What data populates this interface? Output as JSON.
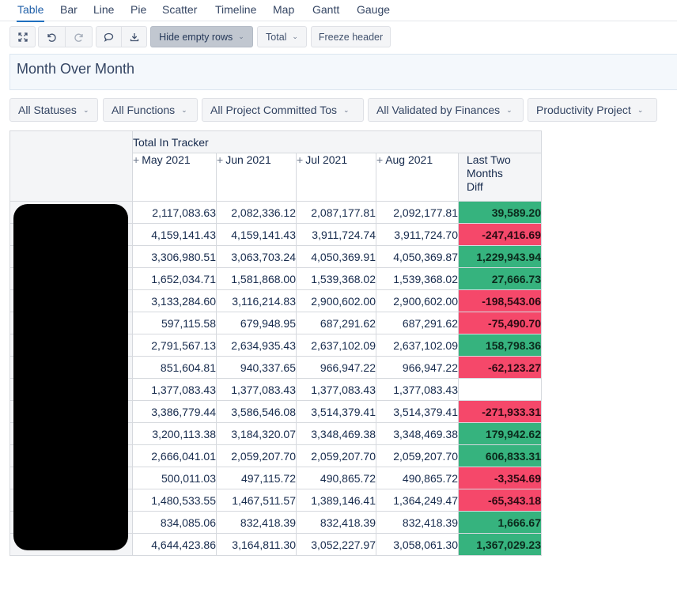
{
  "tabs": [
    "Table",
    "Bar",
    "Line",
    "Pie",
    "Scatter",
    "Timeline",
    "Map",
    "Gantt",
    "Gauge"
  ],
  "active_tab": "Table",
  "toolbar": {
    "hide_empty_rows": "Hide empty rows",
    "total": "Total",
    "freeze_header": "Freeze header",
    "chevron": "⌄"
  },
  "report": {
    "title": "Month Over Month"
  },
  "filters": [
    "All Statuses",
    "All Functions",
    "All Project Committed Tos",
    "All Validated by Finances",
    "Productivity Project"
  ],
  "table": {
    "group_header": "Total In Tracker",
    "columns": [
      {
        "label": "May 2021",
        "expand": "+"
      },
      {
        "label": "Jun 2021",
        "expand": "+"
      },
      {
        "label": "Jul 2021",
        "expand": "+"
      },
      {
        "label": "Aug 2021",
        "expand": "+"
      }
    ],
    "diff_header": [
      "Last Two",
      "Months",
      "Diff"
    ],
    "rows": [
      {
        "values": [
          "2,117,083.63",
          "2,082,336.12",
          "2,087,177.81",
          "2,092,177.81"
        ],
        "diff": "39,589.20",
        "sign": "pos"
      },
      {
        "values": [
          "4,159,141.43",
          "4,159,141.43",
          "3,911,724.74",
          "3,911,724.70"
        ],
        "diff": "-247,416.69",
        "sign": "neg"
      },
      {
        "values": [
          "3,306,980.51",
          "3,063,703.24",
          "4,050,369.91",
          "4,050,369.87"
        ],
        "diff": "1,229,943.94",
        "sign": "pos"
      },
      {
        "values": [
          "1,652,034.71",
          "1,581,868.00",
          "1,539,368.02",
          "1,539,368.02"
        ],
        "diff": "27,666.73",
        "sign": "pos"
      },
      {
        "values": [
          "3,133,284.60",
          "3,116,214.83",
          "2,900,602.00",
          "2,900,602.00"
        ],
        "diff": "-198,543.06",
        "sign": "neg"
      },
      {
        "values": [
          "597,115.58",
          "679,948.95",
          "687,291.62",
          "687,291.62"
        ],
        "diff": "-75,490.70",
        "sign": "neg"
      },
      {
        "values": [
          "2,791,567.13",
          "2,634,935.43",
          "2,637,102.09",
          "2,637,102.09"
        ],
        "diff": "158,798.36",
        "sign": "pos"
      },
      {
        "values": [
          "851,604.81",
          "940,337.65",
          "966,947.22",
          "966,947.22"
        ],
        "diff": "-62,123.27",
        "sign": "neg"
      },
      {
        "values": [
          "1,377,083.43",
          "1,377,083.43",
          "1,377,083.43",
          "1,377,083.43"
        ],
        "diff": "",
        "sign": "none"
      },
      {
        "values": [
          "3,386,779.44",
          "3,586,546.08",
          "3,514,379.41",
          "3,514,379.41"
        ],
        "diff": "-271,933.31",
        "sign": "neg"
      },
      {
        "values": [
          "3,200,113.38",
          "3,184,320.07",
          "3,348,469.38",
          "3,348,469.38"
        ],
        "diff": "179,942.62",
        "sign": "pos"
      },
      {
        "values": [
          "2,666,041.01",
          "2,059,207.70",
          "2,059,207.70",
          "2,059,207.70"
        ],
        "diff": "606,833.31",
        "sign": "pos"
      },
      {
        "values": [
          "500,011.03",
          "497,115.72",
          "490,865.72",
          "490,865.72"
        ],
        "diff": "-3,354.69",
        "sign": "neg"
      },
      {
        "values": [
          "1,480,533.55",
          "1,467,511.57",
          "1,389,146.41",
          "1,364,249.47"
        ],
        "diff": "-65,343.18",
        "sign": "neg"
      },
      {
        "values": [
          "834,085.06",
          "832,418.39",
          "832,418.39",
          "832,418.39"
        ],
        "diff": "1,666.67",
        "sign": "pos"
      },
      {
        "values": [
          "4,644,423.86",
          "3,164,811.30",
          "3,052,227.97",
          "3,058,061.30"
        ],
        "diff": "1,367,029.23",
        "sign": "pos"
      }
    ]
  },
  "colors": {
    "positive": "#36b37e",
    "negative": "#f5486a",
    "accent": "#1f6fbf"
  },
  "icons": [
    "fullscreen-icon",
    "undo-icon",
    "redo-icon",
    "comment-icon",
    "export-icon"
  ]
}
